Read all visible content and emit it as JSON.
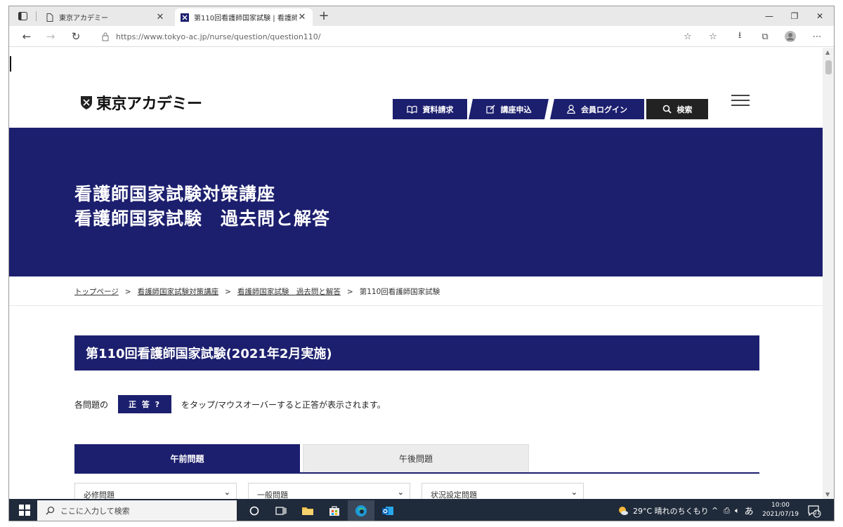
{
  "browser": {
    "tabs": [
      {
        "title": "東京アカデミー"
      },
      {
        "title": "第110回看護師国家試験 | 看護師"
      }
    ],
    "url": "https://www.tokyo-ac.jp/nurse/question/question110/"
  },
  "header": {
    "logo_text": "東京アカデミー",
    "nav": [
      {
        "label": "資料請求",
        "icon": "book-icon"
      },
      {
        "label": "講座申込",
        "icon": "edit-icon"
      },
      {
        "label": "会員ログイン",
        "icon": "user-icon"
      },
      {
        "label": "検索",
        "icon": "search-icon"
      }
    ]
  },
  "hero": {
    "line1": "看護師国家試験対策講座",
    "line2": "看護師国家試験　過去問と解答"
  },
  "breadcrumb": [
    "トップページ",
    "看護師国家試験対策講座",
    "看護師国家試験　過去問と解答",
    "第110回看護師国家試験"
  ],
  "breadcrumb_sep": ">",
  "exam_title": "第110回看護師国家試験(2021年2月実施)",
  "instruction": {
    "prefix": "各問題の",
    "badge": "正 答 ?",
    "suffix": "をタップ/マウスオーバーすると正答が表示されます。"
  },
  "session_tabs": [
    {
      "label": "午前問題",
      "active": true
    },
    {
      "label": "午後問題",
      "active": false
    }
  ],
  "filters": [
    "必修問題",
    "一般問題",
    "状況設定問題"
  ],
  "taskbar": {
    "search_placeholder": "ここに入力して検索",
    "weather": "29°C  晴れのちくもり",
    "ime": "あ",
    "time": "10:00",
    "date": "2021/07/19",
    "notifications": "21"
  },
  "colors": {
    "brand_navy": "#1c1f6e",
    "taskbar": "#1f2a3a"
  }
}
